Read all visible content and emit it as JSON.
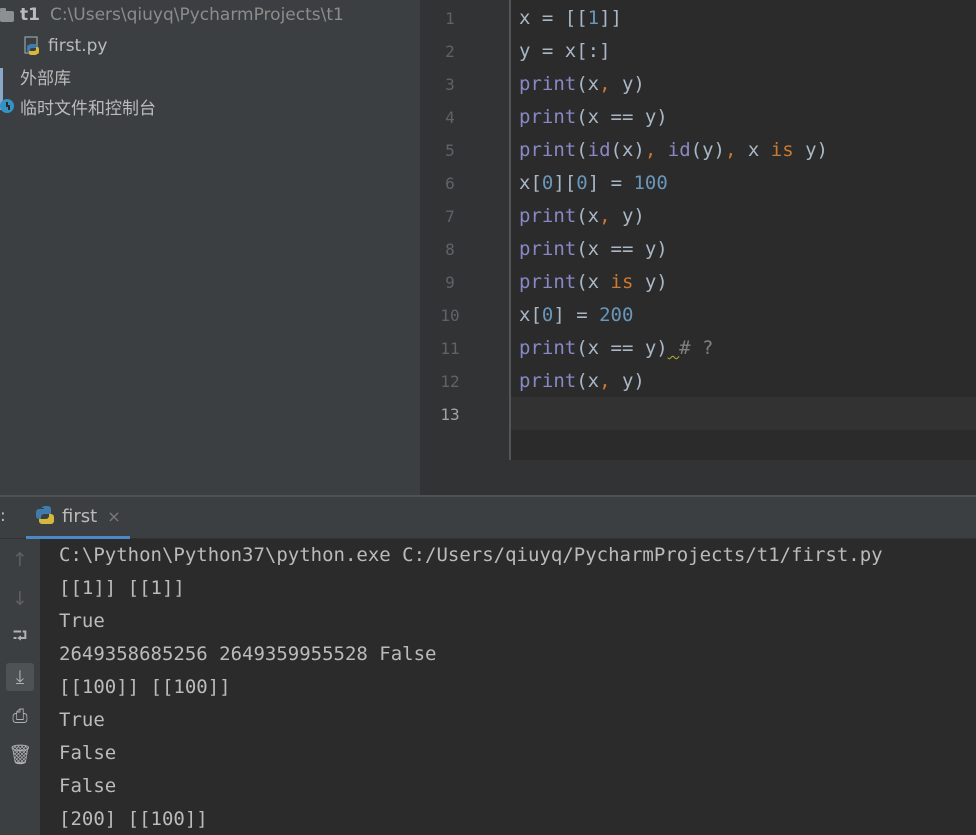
{
  "project_tree": {
    "root_name": "t1",
    "root_path": "C:\\Users\\qiuyq\\PycharmProjects\\t1",
    "file": "first.py",
    "external_libs": "外部库",
    "scratches": "临时文件和控制台"
  },
  "editor": {
    "current_line": 13,
    "lines": [
      {
        "n": "1",
        "tokens": [
          {
            "t": "x = [[",
            "c": ""
          },
          {
            "t": "1",
            "c": "num"
          },
          {
            "t": "]]",
            "c": ""
          }
        ]
      },
      {
        "n": "2",
        "tokens": [
          {
            "t": "y = x[:]",
            "c": ""
          }
        ]
      },
      {
        "n": "3",
        "tokens": [
          {
            "t": "print",
            "c": "fn"
          },
          {
            "t": "(x",
            "c": ""
          },
          {
            "t": ",",
            "c": "kw"
          },
          {
            "t": " y)",
            "c": ""
          }
        ]
      },
      {
        "n": "4",
        "tokens": [
          {
            "t": "print",
            "c": "fn"
          },
          {
            "t": "(x == y)",
            "c": ""
          }
        ]
      },
      {
        "n": "5",
        "tokens": [
          {
            "t": "print",
            "c": "fn"
          },
          {
            "t": "(",
            "c": ""
          },
          {
            "t": "id",
            "c": "fn"
          },
          {
            "t": "(x)",
            "c": ""
          },
          {
            "t": ",",
            "c": "kw"
          },
          {
            "t": " ",
            "c": ""
          },
          {
            "t": "id",
            "c": "fn"
          },
          {
            "t": "(y)",
            "c": ""
          },
          {
            "t": ",",
            "c": "kw"
          },
          {
            "t": " x ",
            "c": ""
          },
          {
            "t": "is",
            "c": "kw"
          },
          {
            "t": " y)",
            "c": ""
          }
        ]
      },
      {
        "n": "6",
        "tokens": [
          {
            "t": "x[",
            "c": ""
          },
          {
            "t": "0",
            "c": "num"
          },
          {
            "t": "][",
            "c": ""
          },
          {
            "t": "0",
            "c": "num"
          },
          {
            "t": "] = ",
            "c": ""
          },
          {
            "t": "100",
            "c": "num"
          }
        ]
      },
      {
        "n": "7",
        "tokens": [
          {
            "t": "print",
            "c": "fn"
          },
          {
            "t": "(x",
            "c": ""
          },
          {
            "t": ",",
            "c": "kw"
          },
          {
            "t": " y)",
            "c": ""
          }
        ]
      },
      {
        "n": "8",
        "tokens": [
          {
            "t": "print",
            "c": "fn"
          },
          {
            "t": "(x == y)",
            "c": ""
          }
        ]
      },
      {
        "n": "9",
        "tokens": [
          {
            "t": "print",
            "c": "fn"
          },
          {
            "t": "(x ",
            "c": ""
          },
          {
            "t": "is",
            "c": "kw"
          },
          {
            "t": " y)",
            "c": ""
          }
        ]
      },
      {
        "n": "10",
        "tokens": [
          {
            "t": "x[",
            "c": ""
          },
          {
            "t": "0",
            "c": "num"
          },
          {
            "t": "] = ",
            "c": ""
          },
          {
            "t": "200",
            "c": "num"
          }
        ]
      },
      {
        "n": "11",
        "tokens": [
          {
            "t": "print",
            "c": "fn"
          },
          {
            "t": "(x == y)",
            "c": ""
          },
          {
            "t": " ",
            "c": "squig"
          },
          {
            "t": "# ?",
            "c": "cm"
          }
        ]
      },
      {
        "n": "12",
        "tokens": [
          {
            "t": "print",
            "c": "fn"
          },
          {
            "t": "(x",
            "c": ""
          },
          {
            "t": ",",
            "c": "kw"
          },
          {
            "t": " y)",
            "c": ""
          }
        ]
      },
      {
        "n": "13",
        "tokens": []
      }
    ]
  },
  "run_panel": {
    "tab_prefix": ":",
    "tab_label": "first",
    "tab_close": "×",
    "toolbar": [
      {
        "name": "rerun-up-icon",
        "glyph": "↑",
        "disabled": true,
        "active": false
      },
      {
        "name": "arrow-down-icon",
        "glyph": "↓",
        "disabled": true,
        "active": false
      },
      {
        "name": "soft-wrap-icon",
        "glyph": "⮒",
        "disabled": false,
        "active": false
      },
      {
        "name": "scroll-to-end-icon",
        "glyph": "⤓",
        "disabled": false,
        "active": true
      },
      {
        "name": "print-icon",
        "glyph": "⎙",
        "disabled": false,
        "active": false
      },
      {
        "name": "trash-icon",
        "glyph": "🗑",
        "disabled": false,
        "active": false
      }
    ],
    "output": [
      "C:\\Python\\Python37\\python.exe C:/Users/qiuyq/PycharmProjects/t1/first.py",
      "[[1]] [[1]]",
      "True",
      "2649358685256 2649359955528 False",
      "[[100]] [[100]]",
      "True",
      "False",
      "False",
      "[200] [[100]]"
    ]
  },
  "colors": {
    "editor_bg": "#2b2b2b",
    "panel_bg": "#3c3f41",
    "function": "#8888c6",
    "number": "#6897bb",
    "keyword": "#cc7832",
    "comment": "#808080",
    "accent": "#4a88c7"
  }
}
